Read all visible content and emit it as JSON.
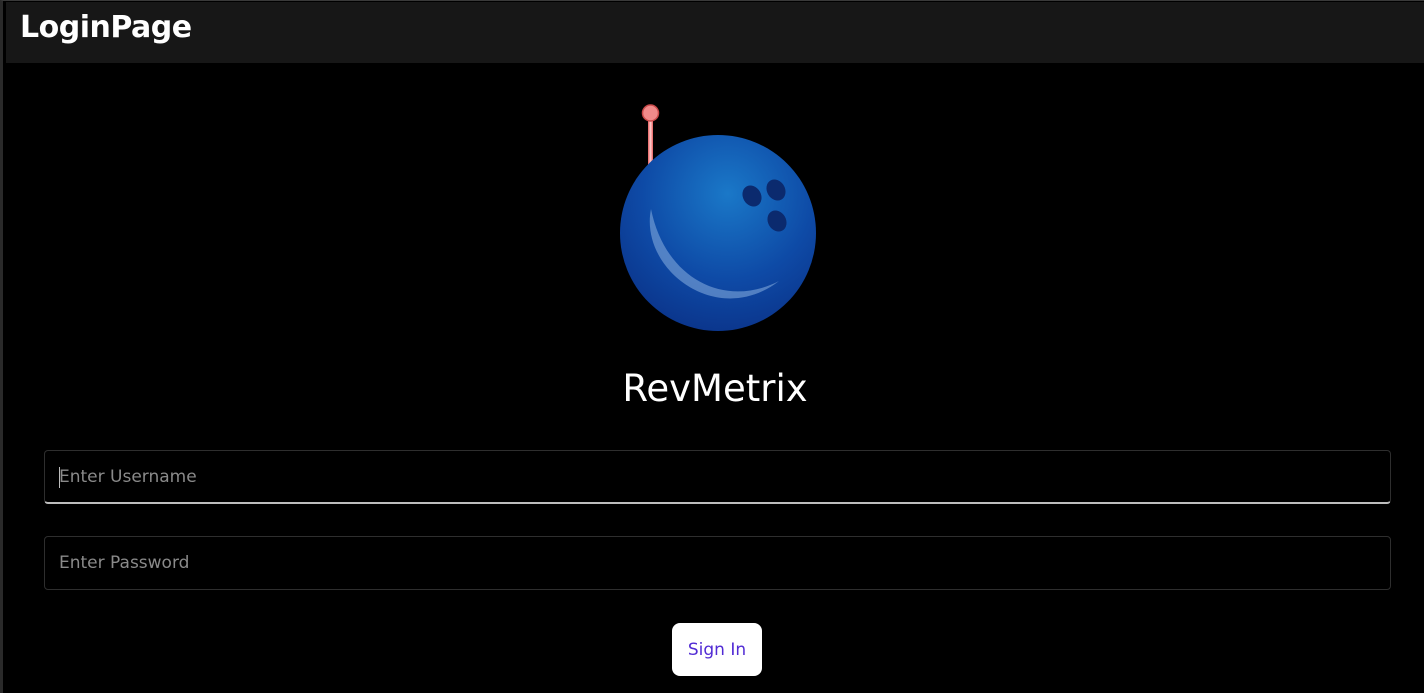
{
  "window": {
    "title": "LoginPage"
  },
  "logo": {
    "icon": "bowling-ball-icon",
    "colors": {
      "ball": "#0e4aa6",
      "ball_dark": "#0a2f84",
      "pin": "#f08a8a"
    }
  },
  "app_name": "RevMetrix",
  "form": {
    "username_placeholder": "Enter Username",
    "username_value": "",
    "password_placeholder": "Enter Password",
    "password_value": "",
    "signin_label": "Sign In"
  },
  "colors": {
    "background": "#000000",
    "titlebar": "#171717",
    "button_bg": "#ffffff",
    "button_text": "#512bd4"
  }
}
